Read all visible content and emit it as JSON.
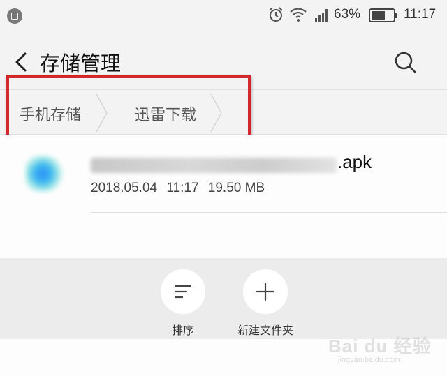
{
  "status_bar": {
    "battery_percent": "63%",
    "time": "11:17",
    "battery_level": 0.63
  },
  "header": {
    "title": "存储管理"
  },
  "breadcrumb": {
    "items": [
      "手机存储",
      "迅雷下载"
    ]
  },
  "highlight_color": "#d3282b",
  "files": [
    {
      "extension": ".apk",
      "date": "2018.05.04",
      "time": "11:17",
      "size": "19.50 MB"
    }
  ],
  "toolbar": {
    "sort_label": "排序",
    "new_folder_label": "新建文件夹"
  },
  "icons": {
    "status_left": "app-notification-icon",
    "alarm": "alarm-clock-icon",
    "wifi": "wifi-icon",
    "signal": "signal-icon",
    "battery": "battery-icon",
    "back": "chevron-left-icon",
    "search": "search-icon",
    "sort": "sort-lines-icon",
    "add": "plus-icon"
  },
  "watermark": {
    "text": "Bai du 经验",
    "url": "jingyan.baidu.com"
  }
}
